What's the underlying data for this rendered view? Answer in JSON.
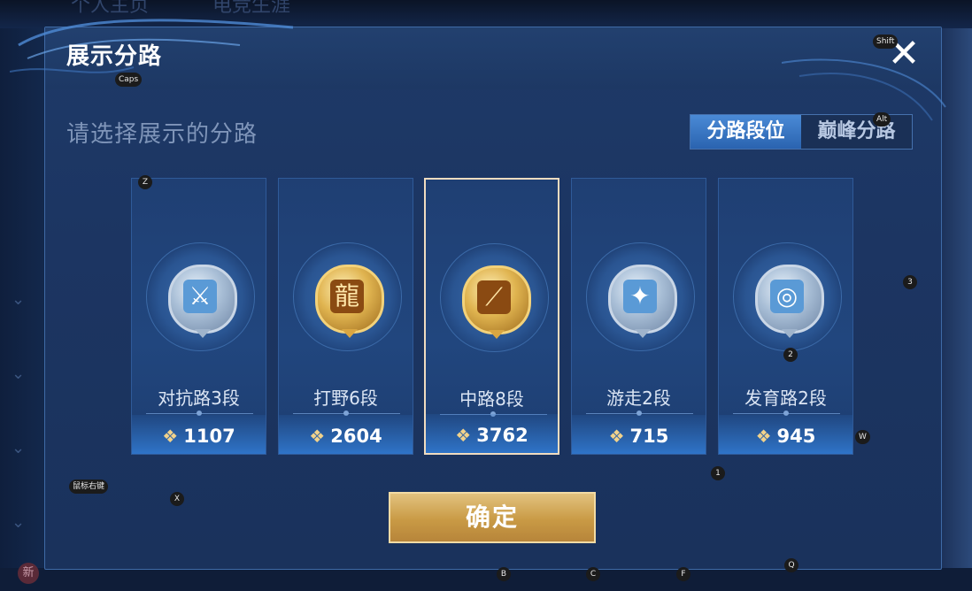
{
  "background": {
    "tabs": [
      "个人主页",
      "电竞生涯"
    ],
    "new_badge": "新"
  },
  "dialog": {
    "title": "展示分路",
    "subtitle": "请选择展示的分路",
    "toggle": {
      "options": [
        "分路段位",
        "巅峰分路"
      ],
      "selected": "分路段位"
    },
    "cards": [
      {
        "lane": "对抗路3段",
        "score": "1107",
        "medal": "silver",
        "icon": "crossed-swords-icon"
      },
      {
        "lane": "打野6段",
        "score": "2604",
        "medal": "gold",
        "icon": "dragon-icon"
      },
      {
        "lane": "中路8段",
        "score": "3762",
        "medal": "gold",
        "icon": "slash-icon",
        "selected": true
      },
      {
        "lane": "游走2段",
        "score": "715",
        "medal": "silver",
        "icon": "wings-icon"
      },
      {
        "lane": "发育路2段",
        "score": "945",
        "medal": "silver",
        "icon": "ring-icon"
      }
    ],
    "confirm_label": "确定",
    "close_glyph": "✕"
  },
  "key_hints": {
    "caps": "Caps",
    "shift": "Shift",
    "alt": "Alt",
    "z": "Z",
    "x": "X",
    "mouse_right": "鼠标右键",
    "three": "3",
    "two": "2",
    "w": "W",
    "one": "1",
    "b": "B",
    "c": "C",
    "f": "F",
    "q": "Q"
  },
  "colors": {
    "accent_blue": "#2f74c8",
    "gold": "#c99a45",
    "selected_border": "#f0dcc0"
  }
}
